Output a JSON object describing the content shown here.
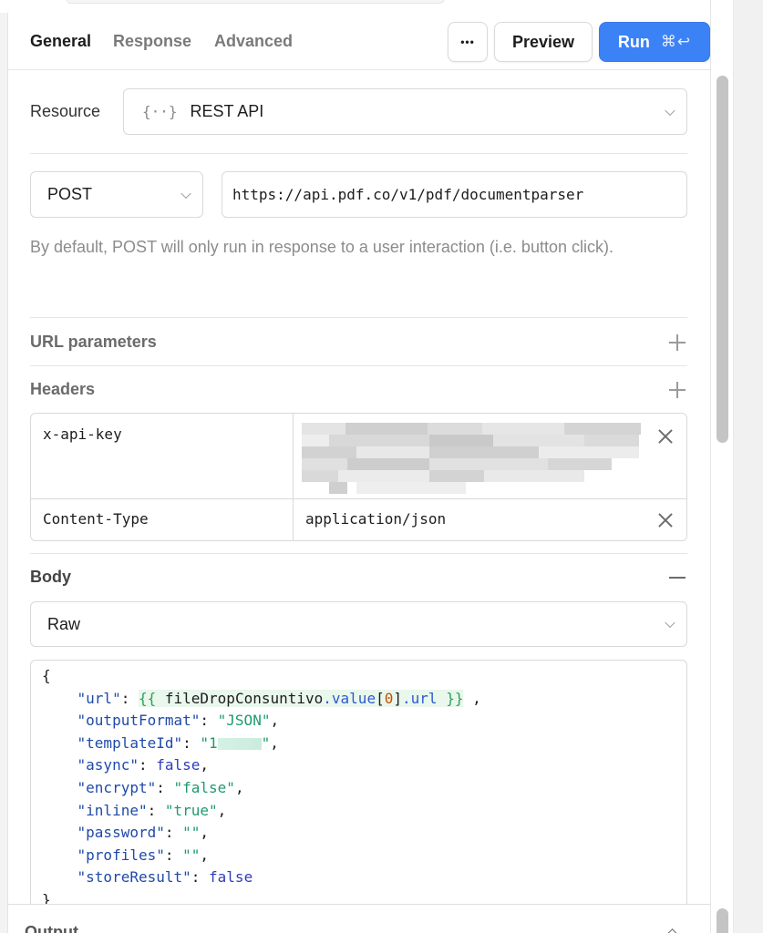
{
  "tabs": [
    {
      "label": "General",
      "active": true
    },
    {
      "label": "Response",
      "active": false
    },
    {
      "label": "Advanced",
      "active": false
    }
  ],
  "toolbar": {
    "more_label": "•••",
    "preview_label": "Preview",
    "run_label": "Run",
    "run_shortcut": "⌘↩",
    "run_color": "#3b82f6"
  },
  "resource": {
    "label": "Resource",
    "icon": "curly-braces-icon",
    "icon_glyph": "{··}",
    "value": "REST API"
  },
  "request": {
    "method": "POST",
    "url": "https://api.pdf.co/v1/pdf/documentparser",
    "hint": "By default, POST will only run in response to a user interaction (i.e. button click)."
  },
  "sections": {
    "url_params": "URL parameters",
    "headers": "Headers",
    "body": "Body",
    "output": "Output"
  },
  "headers": [
    {
      "key": "x-api-key",
      "value": "",
      "redacted": true
    },
    {
      "key": "Content-Type",
      "value": "application/json",
      "redacted": false
    }
  ],
  "body": {
    "type": "Raw",
    "code": {
      "open": "{",
      "close": "}",
      "url_key": "\"url\"",
      "url_template_open": "{{",
      "url_template_var": "fileDropConsuntivo",
      "url_template_dot1": ".",
      "url_template_prop": "value",
      "url_template_idx_open": "[",
      "url_template_idx": "0",
      "url_template_idx_close": "]",
      "url_template_dot2": ".",
      "url_template_prop2": "url",
      "url_template_close": "}}",
      "lines": [
        {
          "key": "\"outputFormat\"",
          "value": "\"JSON\"",
          "kind": "string",
          "comma": true
        },
        {
          "key": "\"templateId\"",
          "value": "\"1",
          "kind": "redacted",
          "comma": true,
          "value_end": "\""
        },
        {
          "key": "\"async\"",
          "value": "false",
          "kind": "bool",
          "comma": true
        },
        {
          "key": "\"encrypt\"",
          "value": "\"false\"",
          "kind": "string",
          "comma": true
        },
        {
          "key": "\"inline\"",
          "value": "\"true\"",
          "kind": "string",
          "comma": true
        },
        {
          "key": "\"password\"",
          "value": "\"\"",
          "kind": "string",
          "comma": true
        },
        {
          "key": "\"profiles\"",
          "value": "\"\"",
          "kind": "string",
          "comma": true
        },
        {
          "key": "\"storeResult\"",
          "value": "false",
          "kind": "bool",
          "comma": false
        }
      ]
    }
  }
}
